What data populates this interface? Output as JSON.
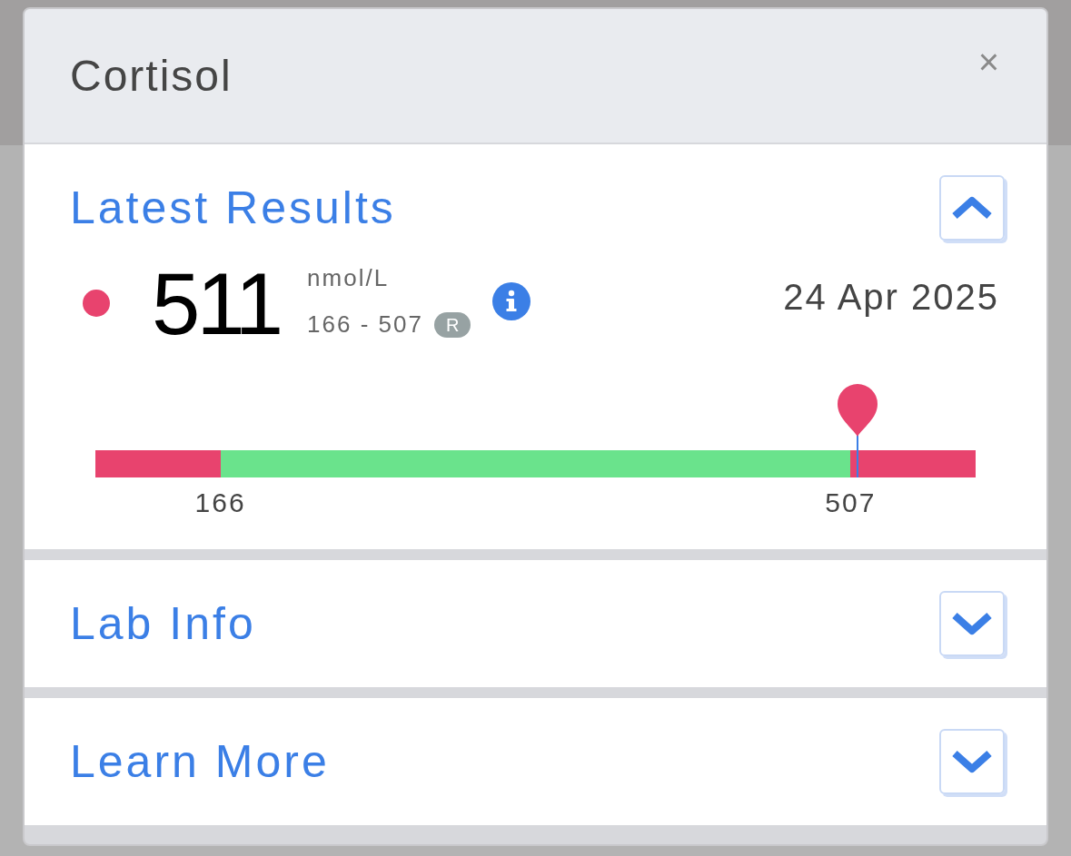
{
  "dialog": {
    "title": "Cortisol",
    "close": "×"
  },
  "sections": [
    {
      "title": "Latest Results",
      "expanded": true,
      "result": {
        "out_of_range": true,
        "value": "511",
        "unit": "nmol/L",
        "range": "166 - 507",
        "range_badge": "R",
        "date": "24 Apr 2025",
        "range_bar": {
          "segments": [
            {
              "color": "#e8436e"
            },
            {
              "color": "#6ae38c"
            },
            {
              "color": "#e8436e"
            }
          ],
          "boundary_labels": [
            "166",
            "507"
          ],
          "marker": {
            "level": 0.866
          }
        }
      }
    },
    {
      "title": "Lab Info",
      "expanded": false
    },
    {
      "title": "Learn More",
      "expanded": false
    }
  ]
}
